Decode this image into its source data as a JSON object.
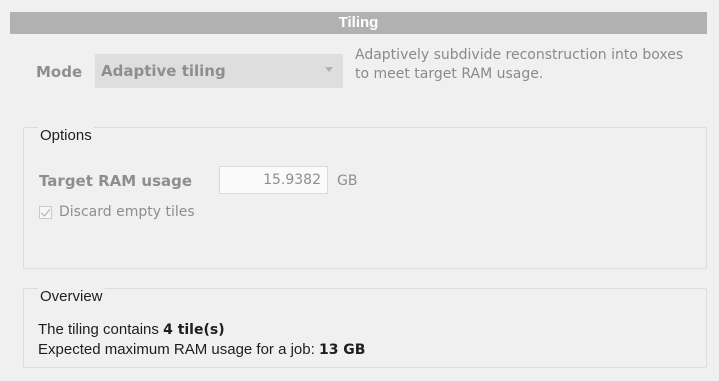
{
  "header": {
    "title": "Tiling"
  },
  "mode": {
    "label": "Mode",
    "selected": "Adaptive tiling",
    "description": "Adaptively subdivide reconstruction into boxes to meet target RAM usage."
  },
  "options": {
    "title": "Options",
    "target_ram_label": "Target RAM usage",
    "target_ram_value": "15.9382",
    "target_ram_unit": "GB",
    "discard_empty_label": "Discard empty tiles",
    "discard_empty_checked": true
  },
  "overview": {
    "title": "Overview",
    "line1_prefix": "The tiling contains ",
    "line1_value": "4 tile(s)",
    "line2_prefix": "Expected maximum RAM usage for a job: ",
    "line2_value": "13 GB"
  }
}
